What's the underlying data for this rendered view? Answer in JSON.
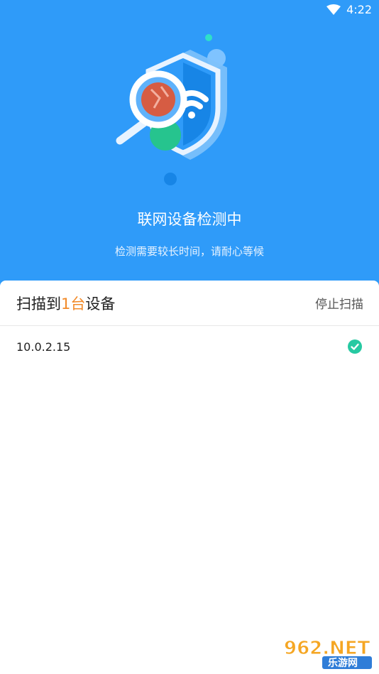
{
  "status_bar": {
    "time": "4:22"
  },
  "scan": {
    "title": "联网设备检测中",
    "subtitle": "检测需要较长时间，请耐心等候"
  },
  "results": {
    "prefix": "扫描到",
    "count": "1台",
    "suffix": "设备",
    "stop_label": "停止扫描",
    "devices": [
      {
        "ip": "10.0.2.15",
        "status": "connected"
      }
    ]
  },
  "watermark": {
    "text_top": "962.NET",
    "text_bottom": "乐游网"
  },
  "colors": {
    "header_bg": "#2f9bf9",
    "accent_orange": "#f28a29",
    "check_green": "#27c9a2"
  }
}
